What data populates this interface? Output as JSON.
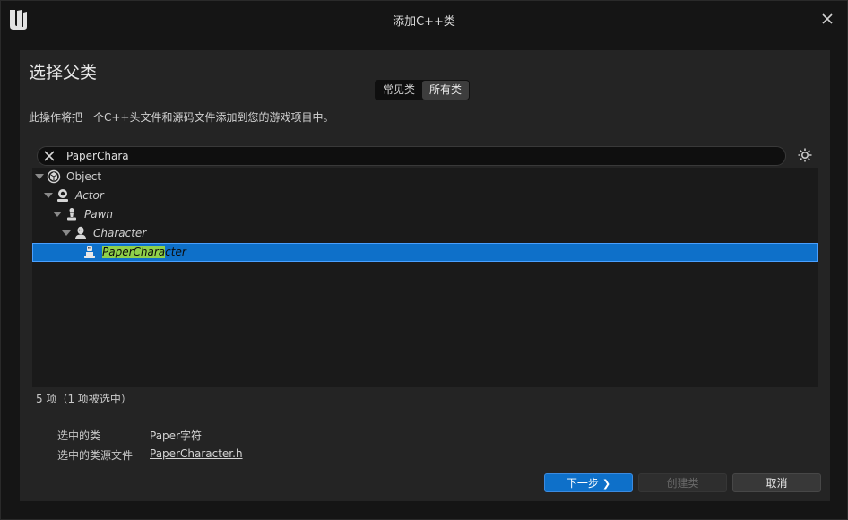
{
  "window": {
    "title": "添加C++类"
  },
  "header": {
    "title": "选择父类"
  },
  "mode_toggle": {
    "options": [
      "常见类",
      "所有类"
    ],
    "active": "所有类"
  },
  "description": "此操作将把一个C++头文件和源码文件添加到您的游戏项目中。",
  "search": {
    "value": "PaperChara",
    "placeholder": ""
  },
  "tree": {
    "items": [
      {
        "label": "Object",
        "icon": "object-icon",
        "expanded": true,
        "italic": false
      },
      {
        "label": "Actor",
        "icon": "actor-icon",
        "expanded": true,
        "italic": true
      },
      {
        "label": "Pawn",
        "icon": "pawn-icon",
        "expanded": true,
        "italic": true
      },
      {
        "label": "Character",
        "icon": "character-icon",
        "expanded": true,
        "italic": true
      },
      {
        "label_match": "PaperChara",
        "label_rest": "cter",
        "icon": "paper-character-icon",
        "selected": true,
        "italic": true
      }
    ]
  },
  "status": {
    "count_text": "5 项（1 项被选中）"
  },
  "selection_info": {
    "class_label": "选中的类",
    "class_value": "Paper字符",
    "source_label": "选中的类源文件",
    "source_value": "PaperCharacter.h"
  },
  "buttons": {
    "next": "下一步",
    "create": "创建类",
    "cancel": "取消"
  },
  "colors": {
    "accent": "#0e70c9",
    "match_highlight": "#8fd04a",
    "panel": "#242424",
    "background": "#151515"
  }
}
